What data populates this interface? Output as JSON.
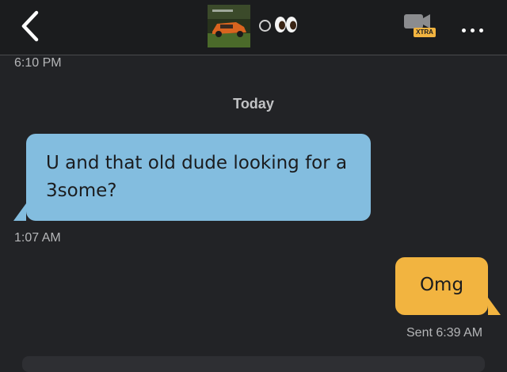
{
  "header": {
    "back_icon": "chevron-left-icon",
    "avatar_alt": "profile-photo-orange-car",
    "status_emoji": "eyes",
    "video_icon": "video-camera-icon",
    "xtra_label": "XTRA",
    "more_icon": "more-dots-icon"
  },
  "chat": {
    "top_timestamp": "6:10 PM",
    "date_separator": "Today",
    "messages": [
      {
        "direction": "received",
        "text": "U and that old dude looking for a 3some?",
        "timestamp": "1:07 AM"
      },
      {
        "direction": "sent",
        "text": "Omg",
        "timestamp": "Sent 6:39 AM"
      }
    ]
  },
  "colors": {
    "background": "#222326",
    "header_background": "#1b1c1e",
    "received_bubble": "#83bddf",
    "sent_bubble": "#f2b440",
    "xtra_badge": "#f2b440",
    "timestamp_text": "#b5b6b8"
  }
}
